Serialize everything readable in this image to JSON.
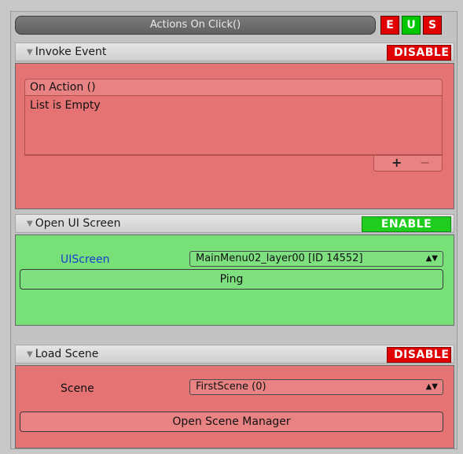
{
  "header": {
    "title": "Actions On Click()",
    "buttons": [
      {
        "label": "E",
        "color": "#e00000"
      },
      {
        "label": "U",
        "color": "#00c800"
      },
      {
        "label": "S",
        "color": "#e00000"
      }
    ]
  },
  "invoke": {
    "title": "Invoke Event",
    "toggle": "DISABLE",
    "event_name": "On Action ()",
    "list_text": "List is Empty",
    "add": "+",
    "remove": "−"
  },
  "open_ui": {
    "title": "Open UI Screen",
    "toggle": "ENABLE",
    "field_label": "UIScreen",
    "field_value": "MainMenu02_layer00 [ID 14552]",
    "ping": "Ping"
  },
  "load_scene": {
    "title": "Load Scene",
    "toggle": "DISABLE",
    "field_label": "Scene",
    "field_value": "FirstScene (0)",
    "button": "Open Scene Manager"
  },
  "colors": {
    "disable": "#e00000",
    "enable": "#1ecd1e",
    "red_panel": "#e57373",
    "green_panel": "#77e077",
    "link_blue": "#1a3fd0"
  }
}
